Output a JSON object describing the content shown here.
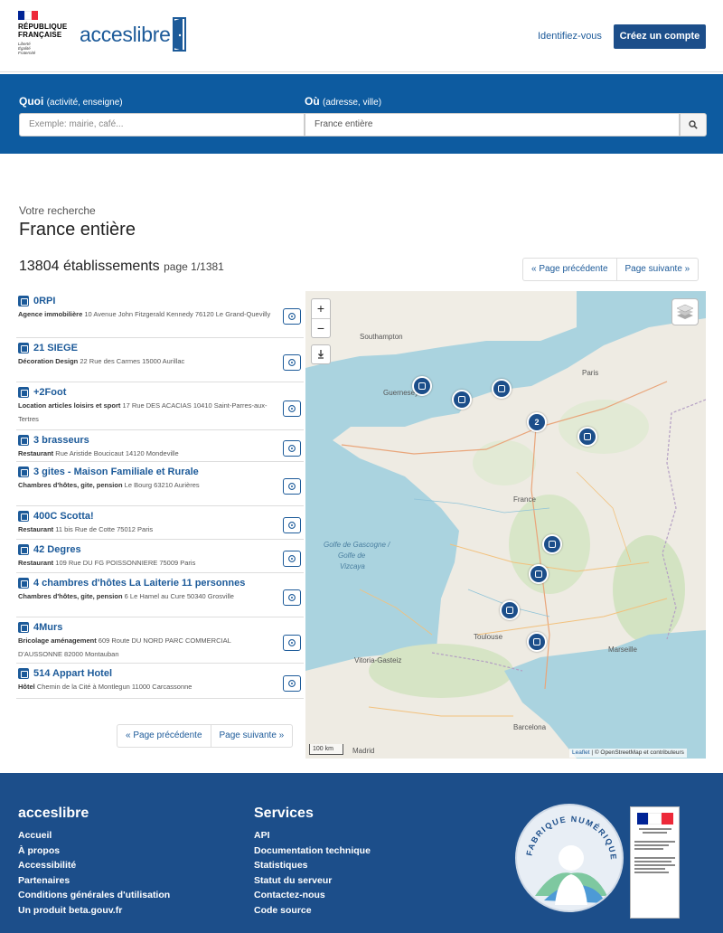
{
  "header": {
    "rf_name_line1": "RÉPUBLIQUE",
    "rf_name_line2": "FRANÇAISE",
    "rf_motto_1": "Liberté",
    "rf_motto_2": "Égalité",
    "rf_motto_3": "Fraternité",
    "brand_prefix": "acces",
    "brand_suffix": "libre",
    "login_link": "Identifiez-vous",
    "signup_button": "Créez un compte"
  },
  "search": {
    "what_label": "Quoi",
    "what_hint": "(activité, enseigne)",
    "what_placeholder": "Exemple: mairie, café...",
    "where_label": "Où",
    "where_hint": "(adresse, ville)",
    "where_value": "France entière",
    "button_icon": "search-icon"
  },
  "results": {
    "caption": "Votre recherche",
    "title": "France entière",
    "count_text": "13804 établissements",
    "page_text": "page 1/1381",
    "prev_label": "« Page précédente",
    "next_label": "Page suivante »"
  },
  "items": [
    {
      "name": "0RPI",
      "category": "Agence immobilière",
      "address": "10 Avenue John Fitzgerald Kennedy 76120 Le Grand-Quevilly",
      "icon": "building-icon"
    },
    {
      "name": "21 SIEGE",
      "category": "Décoration Design",
      "address": "22 Rue des Carmes 15000 Aurillac",
      "icon": "paint-roller-icon"
    },
    {
      "name": "+2Foot",
      "category": "Location articles loisirs et sport",
      "address": "17 Rue DES ACACIAS 10410 Saint-Parres-aux-Tertres",
      "icon": "sport-icon"
    },
    {
      "name": "3 brasseurs",
      "category": "Restaurant",
      "address": "Rue Aristide Boucicaut 14120 Mondeville",
      "icon": "restaurant-icon"
    },
    {
      "name": "3 gites - Maison Familiale et Rurale",
      "category": "Chambres d'hôtes, gite, pension",
      "address": "Le Bourg 63210 Aurières",
      "icon": "bed-icon"
    },
    {
      "name": "400C Scotta!",
      "category": "Restaurant",
      "address": "11 bis Rue de Cotte 75012 Paris",
      "icon": "restaurant-icon"
    },
    {
      "name": "42 Degres",
      "category": "Restaurant",
      "address": "109 Rue DU FG POISSONNIERE 75009 Paris",
      "icon": "restaurant-icon"
    },
    {
      "name": "4 chambres d'hôtes La Laiterie 11 personnes",
      "category": "Chambres d'hôtes, gite, pension",
      "address": "6 Le Hamel au Cure 50340 Grosville",
      "icon": "bed-icon"
    },
    {
      "name": "4Murs",
      "category": "Bricolage aménagement",
      "address": "609 Route DU NORD PARC COMMERCIAL D'AUSSONNE 82000 Montauban",
      "icon": "tools-icon"
    },
    {
      "name": "514 Appart Hotel",
      "category": "Hôtel",
      "address": "Chemin de la Cité à Montlegun 11000 Carcassonne",
      "icon": "hotel-icon"
    }
  ],
  "map": {
    "zoom_in": "+",
    "zoom_out": "−",
    "scale_label": "100 km",
    "attribution_leaflet": "Leaflet",
    "attribution_rest": " | © OpenStreetMap et contributeurs",
    "cluster_count": "2",
    "labels": {
      "southampton": "Southampton",
      "guernesey": "Guernesey",
      "golfe_1": "Golfe de Gascogne /",
      "golfe_2": "Golfe de",
      "golfe_3": "Vizcaya",
      "france": "France",
      "toulouse": "Toulouse",
      "marseille": "Marseille",
      "vitoria": "Vitoria-Gasteiz",
      "barcelona": "Barcelona",
      "madrid": "Madrid",
      "paris": "Paris"
    }
  },
  "footer": {
    "col1_title": "acceslibre",
    "col1_links": [
      "Accueil",
      "À propos",
      "Accessibilité",
      "Partenaires",
      "Conditions générales d'utilisation",
      "Un produit beta.gouv.fr"
    ],
    "col2_title": "Services",
    "col2_links": [
      "API",
      "Documentation technique",
      "Statistiques",
      "Statut du serveur",
      "Contactez-nous",
      "Code source"
    ],
    "badge_text": "FABRIQUE NUMÉRIQUE"
  },
  "colors": {
    "primary": "#1c4e8a",
    "band": "#0d5ba0",
    "link": "#1c5a99"
  }
}
